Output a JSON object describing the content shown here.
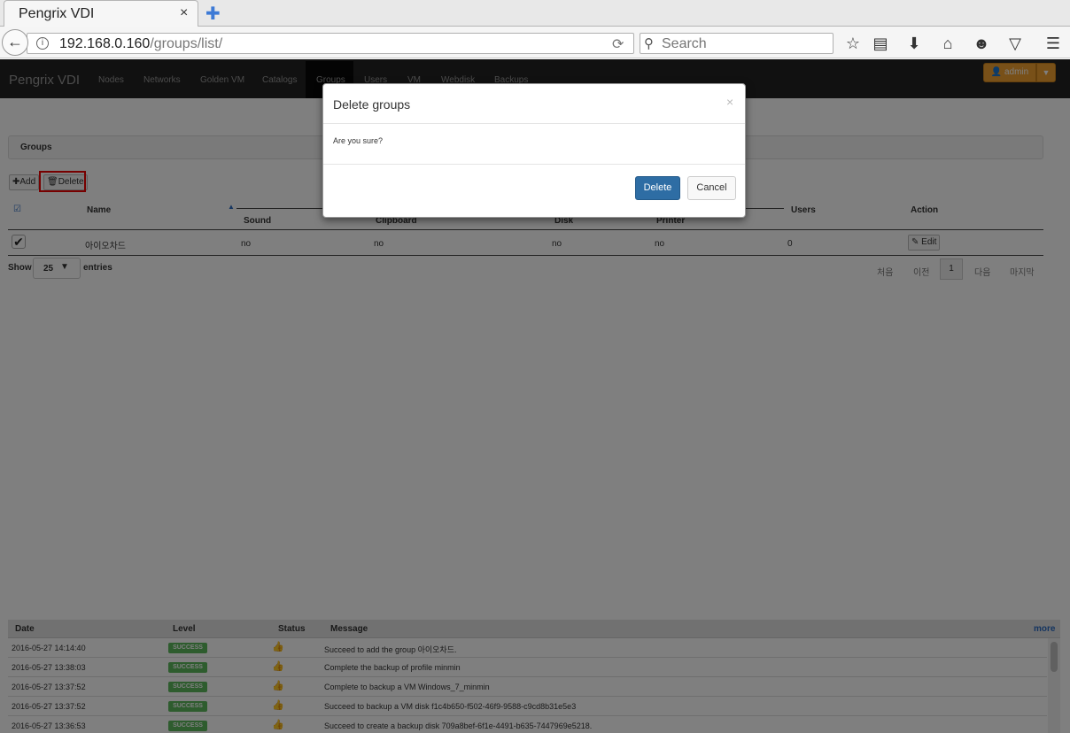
{
  "browser": {
    "tab_title": "Pengrix VDI",
    "tab_close": "×",
    "new_tab": "✚",
    "url_host": "192.168.0.160",
    "url_path": "/groups/list/",
    "search_placeholder": "Search",
    "icons": [
      "back-arrow-icon",
      "info-icon",
      "reload-icon",
      "search-icon",
      "bookmark-star-icon",
      "reading-list-icon",
      "download-icon",
      "home-icon",
      "smiley-icon",
      "pocket-icon",
      "menu-icon"
    ]
  },
  "app": {
    "brand": "Pengrix VDI",
    "nav": [
      "Nodes",
      "Networks",
      "Golden VM",
      "Catalogs",
      "Groups",
      "Users",
      "VM",
      "Webdisk",
      "Backups"
    ],
    "user_button": "admin",
    "panel_title": "Groups",
    "add_label": "Add",
    "delete_label": "Delete",
    "table": {
      "headers": {
        "name": "Name",
        "sound": "Sound",
        "clipboard": "Clipboard",
        "disk": "Disk",
        "printer": "Printer",
        "users": "Users",
        "action": "Action"
      },
      "rows": [
        {
          "name": "아이오차드",
          "sound": "no",
          "clipboard": "no",
          "disk": "no",
          "printer": "no",
          "users": "0",
          "action": "Edit"
        }
      ]
    },
    "show_label": "Show",
    "page_size": "25",
    "entries_label": "entries",
    "pager": {
      "first": "처음",
      "prev": "이전",
      "current": "1",
      "next": "다음",
      "last": "마지막"
    }
  },
  "log": {
    "headers": {
      "date": "Date",
      "level": "Level",
      "status": "Status",
      "message": "Message"
    },
    "more": "more",
    "rows": [
      {
        "date": "2016-05-27 14:14:40",
        "level": "SUCCESS",
        "message": "Succeed to add the group 아이오차드."
      },
      {
        "date": "2016-05-27 13:38:03",
        "level": "SUCCESS",
        "message": "Complete the backup of profile minmin"
      },
      {
        "date": "2016-05-27 13:37:52",
        "level": "SUCCESS",
        "message": "Complete to backup a VM Windows_7_minmin"
      },
      {
        "date": "2016-05-27 13:37:52",
        "level": "SUCCESS",
        "message": "Succeed to backup a VM disk f1c4b650-f502-46f9-9588-c9cd8b31e5e3"
      },
      {
        "date": "2016-05-27 13:36:53",
        "level": "SUCCESS",
        "message": "Succeed to create a backup disk 709a8bef-6f1e-4491-b635-7447969e5218."
      }
    ]
  },
  "modal": {
    "title": "Delete groups",
    "close": "×",
    "body": "Are you sure?",
    "confirm": "Delete",
    "cancel": "Cancel"
  },
  "colors": {
    "navbar_bg": "#222222",
    "admin_orange": "#f0a030",
    "success_green": "#5cb85c",
    "primary_blue": "#2e6da4",
    "highlight_red": "#ee0000"
  }
}
